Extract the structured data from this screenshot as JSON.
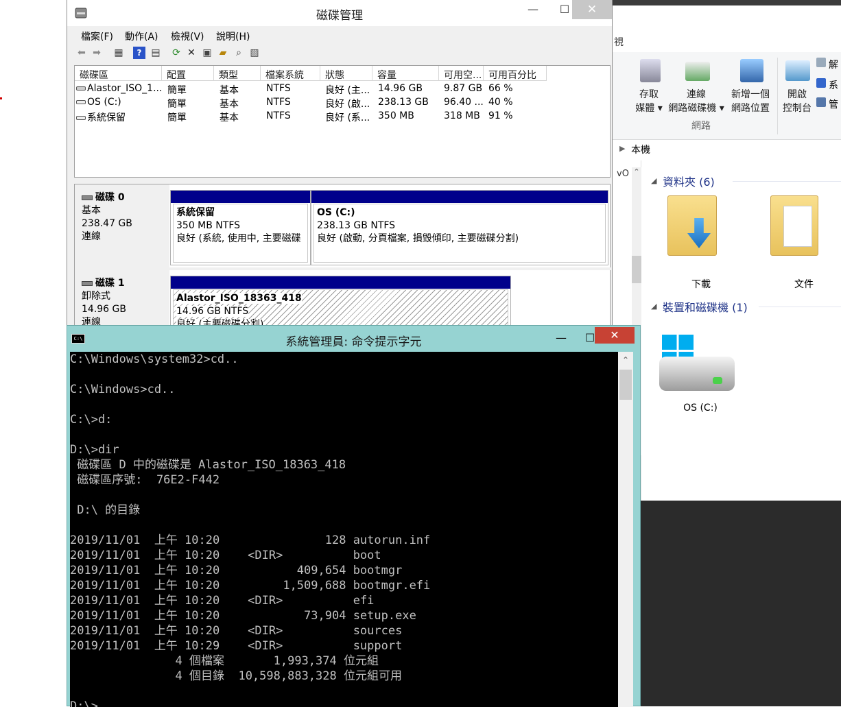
{
  "disk_mgmt": {
    "title": "磁碟管理",
    "menu": [
      "檔案(F)",
      "動作(A)",
      "檢視(V)",
      "說明(H)"
    ],
    "columns": [
      "磁碟區",
      "配置",
      "類型",
      "檔案系統",
      "狀態",
      "容量",
      "可用空...",
      "可用百分比"
    ],
    "volumes": [
      [
        "Alastor_ISO_1...",
        "簡單",
        "基本",
        "NTFS",
        "良好 (主...",
        "14.96 GB",
        "9.87 GB",
        "66 %"
      ],
      [
        "OS (C:)",
        "簡單",
        "基本",
        "NTFS",
        "良好 (啟...",
        "238.13 GB",
        "96.40 ...",
        "40 %"
      ],
      [
        "系統保留",
        "簡單",
        "基本",
        "NTFS",
        "良好 (系...",
        "350 MB",
        "318 MB",
        "91 %"
      ]
    ],
    "disk0": {
      "name": "磁碟 0",
      "type": "基本",
      "size": "238.47 GB",
      "status": "連線",
      "p1": {
        "name": "系統保留",
        "size": "350 MB NTFS",
        "status": "良好 (系統, 使用中, 主要磁碟"
      },
      "p2": {
        "name": "OS  (C:)",
        "size": "238.13 GB NTFS",
        "status": "良好 (啟動, 分頁檔案, 損毀傾印, 主要磁碟分割)"
      }
    },
    "disk1": {
      "name": "磁碟 1",
      "type": "卸除式",
      "size": "14.96 GB",
      "status": "連線",
      "p1": {
        "name": "Alastor_ISO_18363_418",
        "size": "14.96 GB NTFS",
        "status": "良好 (主要磁碟分割)"
      }
    }
  },
  "explorer": {
    "tab_fragment": "視",
    "ribbon": {
      "access_media": "存取\n媒體",
      "map_drive": "連線\n網路磁碟機",
      "add_location": "新增一個\n網路位置",
      "open_cp": "開啟\n控制台",
      "group_network": "網路",
      "side_items": [
        "解",
        "系",
        "管"
      ]
    },
    "breadcrumb": "本機",
    "nav_fragment": "vO",
    "folders_header": "資料夾 (6)",
    "folders": [
      "下載",
      "文件"
    ],
    "devices_header": "裝置和磁碟機 (1)",
    "drive_label": "OS (C:)"
  },
  "cmd": {
    "title": "系統管理員: 命令提示字元",
    "lines": [
      "C:\\Windows\\system32>cd..",
      "",
      "C:\\Windows>cd..",
      "",
      "C:\\>d:",
      "",
      "D:\\>dir",
      " 磁碟區 D 中的磁碟是 Alastor_ISO_18363_418",
      " 磁碟區序號:  76E2-F442",
      "",
      " D:\\ 的目錄",
      "",
      "2019/11/01  上午 10:20               128 autorun.inf",
      "2019/11/01  上午 10:20    <DIR>          boot",
      "2019/11/01  上午 10:20           409,654 bootmgr",
      "2019/11/01  上午 10:20         1,509,688 bootmgr.efi",
      "2019/11/01  上午 10:20    <DIR>          efi",
      "2019/11/01  上午 10:20            73,904 setup.exe",
      "2019/11/01  上午 10:20    <DIR>          sources",
      "2019/11/01  上午 10:29    <DIR>          support",
      "               4 個檔案       1,993,374 位元組",
      "               4 個目錄  10,598,883,328 位元組可用",
      "",
      "D:\\>"
    ]
  }
}
